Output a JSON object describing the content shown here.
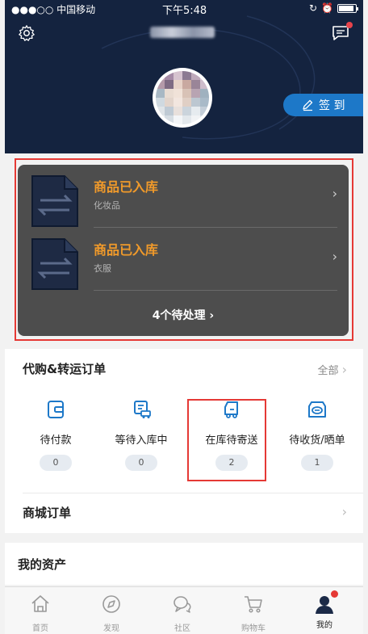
{
  "status_bar": {
    "carrier": "●●●○○ 中国移动 ",
    "time": "下午5:48"
  },
  "header": {
    "username": "█████",
    "signin_label": "签 到"
  },
  "notices": [
    {
      "title": "商品已入库",
      "subtitle": "化妆品"
    },
    {
      "title": "商品已入库",
      "subtitle": "衣服"
    }
  ],
  "pending_label": "4个待处理 ›",
  "orders": {
    "title": "代购&转运订单",
    "all_label": "全部",
    "items": [
      {
        "label": "待付款",
        "count": "0",
        "icon": "wallet-icon"
      },
      {
        "label": "等待入库中",
        "count": "0",
        "icon": "truck-list-icon"
      },
      {
        "label": "在库待寄送",
        "count": "2",
        "icon": "delivery-truck-icon"
      },
      {
        "label": "待收货/晒单",
        "count": "1",
        "icon": "package-icon"
      }
    ]
  },
  "mall_orders_label": "商城订单",
  "assets_label": "我的资产",
  "tabs": [
    {
      "label": "首页",
      "icon": "home-icon"
    },
    {
      "label": "发现",
      "icon": "compass-icon"
    },
    {
      "label": "社区",
      "icon": "community-icon"
    },
    {
      "label": "购物车",
      "icon": "cart-icon"
    },
    {
      "label": "我的",
      "icon": "profile-icon"
    }
  ],
  "colors": {
    "header_bg": "#14233f",
    "accent_orange": "#f19a2a",
    "signin_blue": "#1d78c8",
    "highlight_red": "#e53935"
  }
}
